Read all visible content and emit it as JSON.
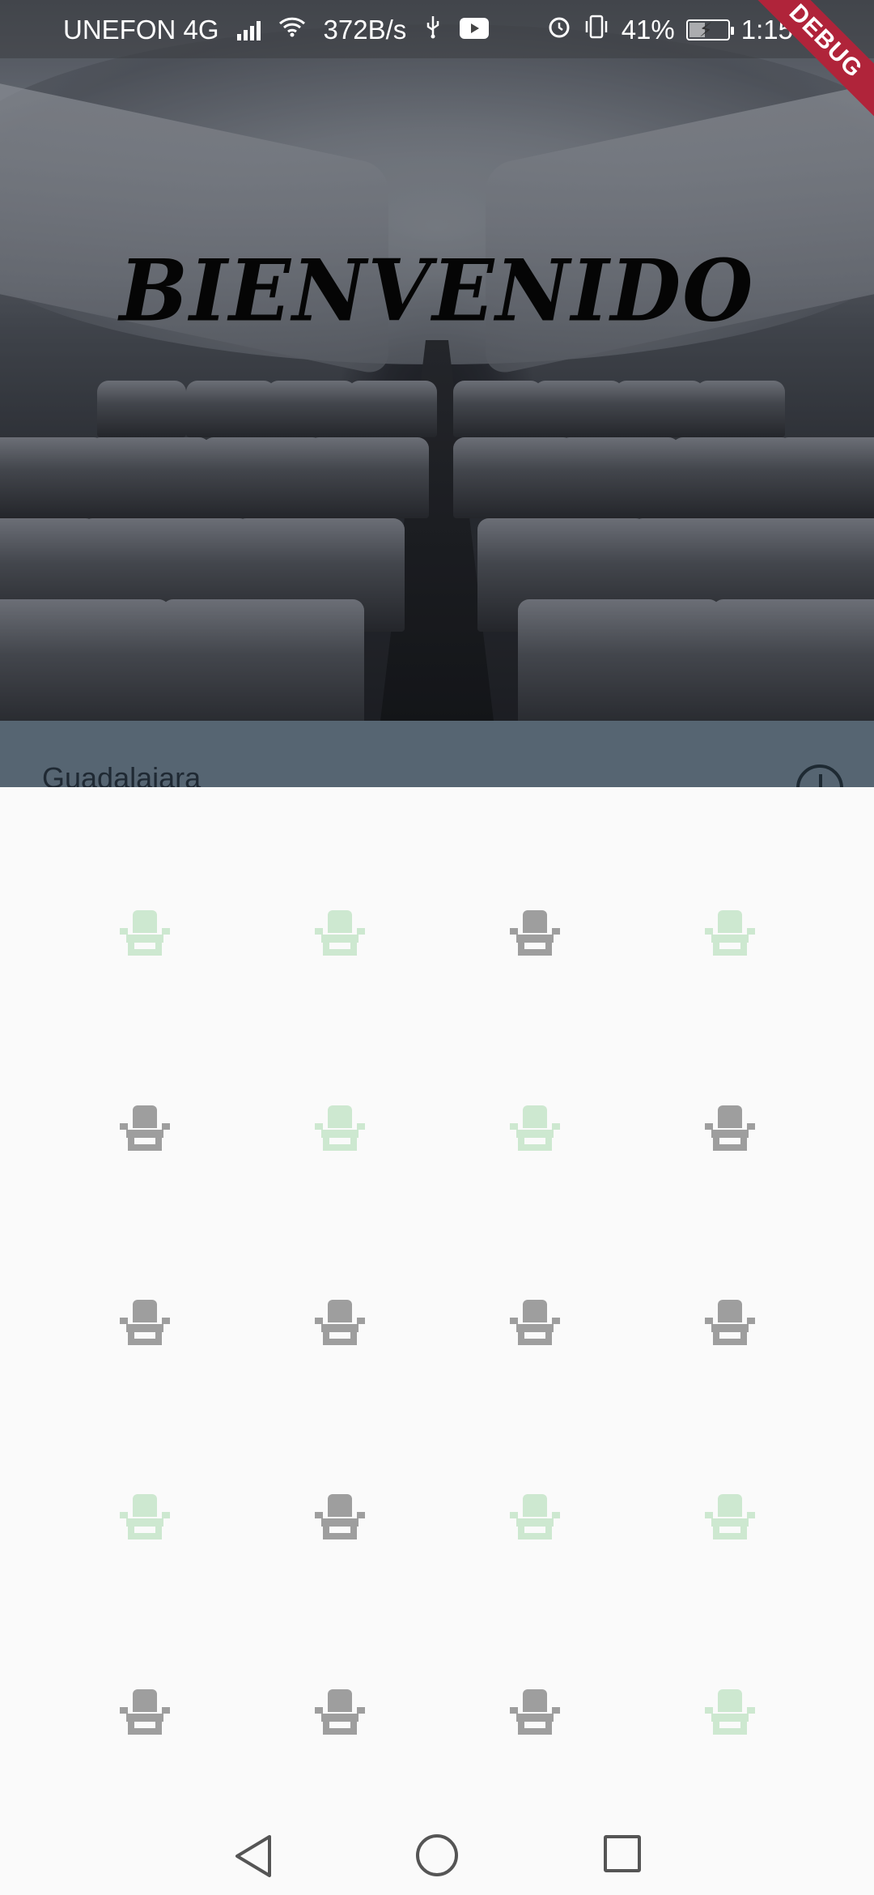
{
  "status_bar": {
    "carrier": "UNEFON 4G",
    "net_speed": "372B/s",
    "battery": "41%",
    "battery_level": 0.41,
    "time": "1:15"
  },
  "debug_banner": "DEBUG",
  "hero": {
    "title": "BIENVENIDO"
  },
  "selector": {
    "city": "Guadalajara"
  },
  "colors": {
    "seat_available": "#cde8d0",
    "seat_occupied": "#9e9e9e",
    "strip_bg": "#566572"
  },
  "seats": [
    [
      "available",
      "available",
      "occupied",
      "available"
    ],
    [
      "occupied",
      "available",
      "available",
      "occupied"
    ],
    [
      "occupied",
      "occupied",
      "occupied",
      "occupied"
    ],
    [
      "available",
      "occupied",
      "available",
      "available"
    ],
    [
      "occupied",
      "occupied",
      "occupied",
      "available"
    ]
  ]
}
